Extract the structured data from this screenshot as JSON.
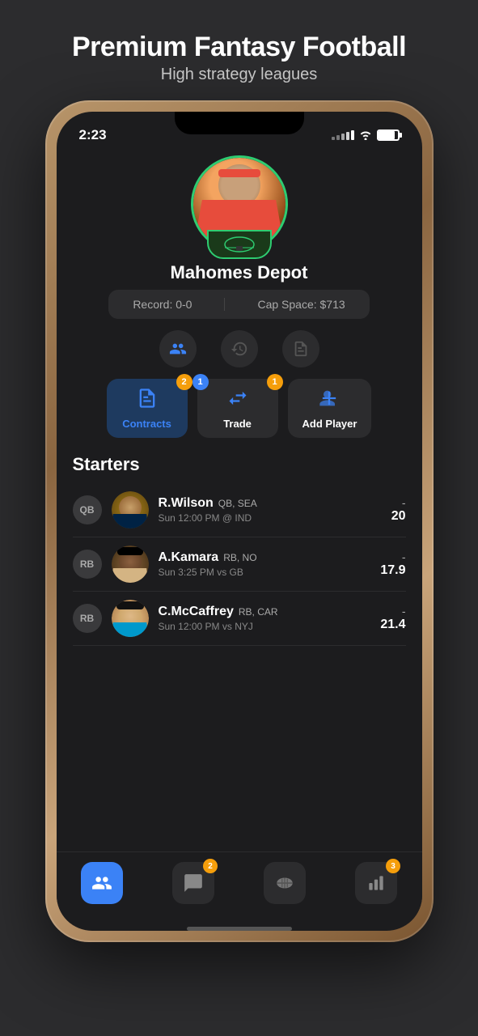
{
  "header": {
    "title": "Premium Fantasy Football",
    "subtitle": "High strategy leagues"
  },
  "status_bar": {
    "time": "2:23",
    "battery_level": 85
  },
  "profile": {
    "team_name": "Mahomes Depot",
    "record_label": "Record: 0-0",
    "cap_space_label": "Cap Space: $713"
  },
  "tabs": [
    {
      "label": "team",
      "icon": "team-icon"
    },
    {
      "label": "history",
      "icon": "history-icon"
    },
    {
      "label": "roster",
      "icon": "roster-icon"
    }
  ],
  "actions": [
    {
      "label": "Contracts",
      "badge": "2",
      "badge_color": "orange",
      "active": true
    },
    {
      "label": "Trade",
      "badge_left": "1",
      "badge_right": "1",
      "active": false
    },
    {
      "label": "Add Player",
      "active": false
    }
  ],
  "starters": {
    "title": "Starters",
    "players": [
      {
        "position": "QB",
        "name": "R.Wilson",
        "pos_team": "QB, SEA",
        "game": "Sun 12:00 PM @ IND",
        "score_dash": "-",
        "score": "20"
      },
      {
        "position": "RB",
        "name": "A.Kamara",
        "pos_team": "RB, NO",
        "game": "Sun 3:25 PM vs GB",
        "score_dash": "-",
        "score": "17.9"
      },
      {
        "position": "RB",
        "name": "C.McCaffrey",
        "pos_team": "RB, CAR",
        "game": "Sun 12:00 PM vs NYJ",
        "score_dash": "-",
        "score": "21.4"
      }
    ]
  },
  "bottom_nav": [
    {
      "icon": "team-icon",
      "active": true,
      "badge": null
    },
    {
      "icon": "chat-icon",
      "active": false,
      "badge": "2"
    },
    {
      "icon": "football-icon",
      "active": false,
      "badge": null
    },
    {
      "icon": "stats-icon",
      "active": false,
      "badge": "3"
    }
  ]
}
